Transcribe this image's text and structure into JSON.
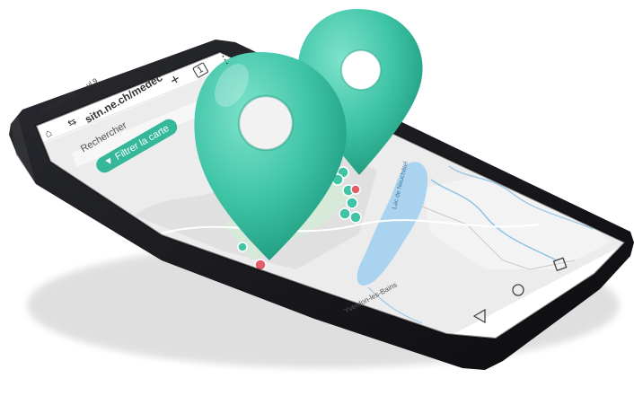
{
  "browser": {
    "status_bar": "Salt LiveMac ··· ul 9",
    "url": "sitn.ne.ch/medec",
    "tabs_count": "1"
  },
  "icons": [
    "home-icon",
    "tune-icon",
    "plus-icon",
    "tabs-icon",
    "menu-icon",
    "filter-icon",
    "back-icon",
    "home-nav-icon",
    "recents-icon",
    "location-pin-icon"
  ],
  "map": {
    "search_placeholder": "Rechercher",
    "filter_label": "Filtrer la carte",
    "lake_label": "Lac de Neuchâtel",
    "city_label": "Yverdon-les-Bains"
  },
  "colors": {
    "pin": "#3fc4a6",
    "accent": "#35b89a",
    "phone_body": "#17181c",
    "water": "#a9d3ef",
    "land": "#ececec",
    "marker": "#e35d6a"
  }
}
